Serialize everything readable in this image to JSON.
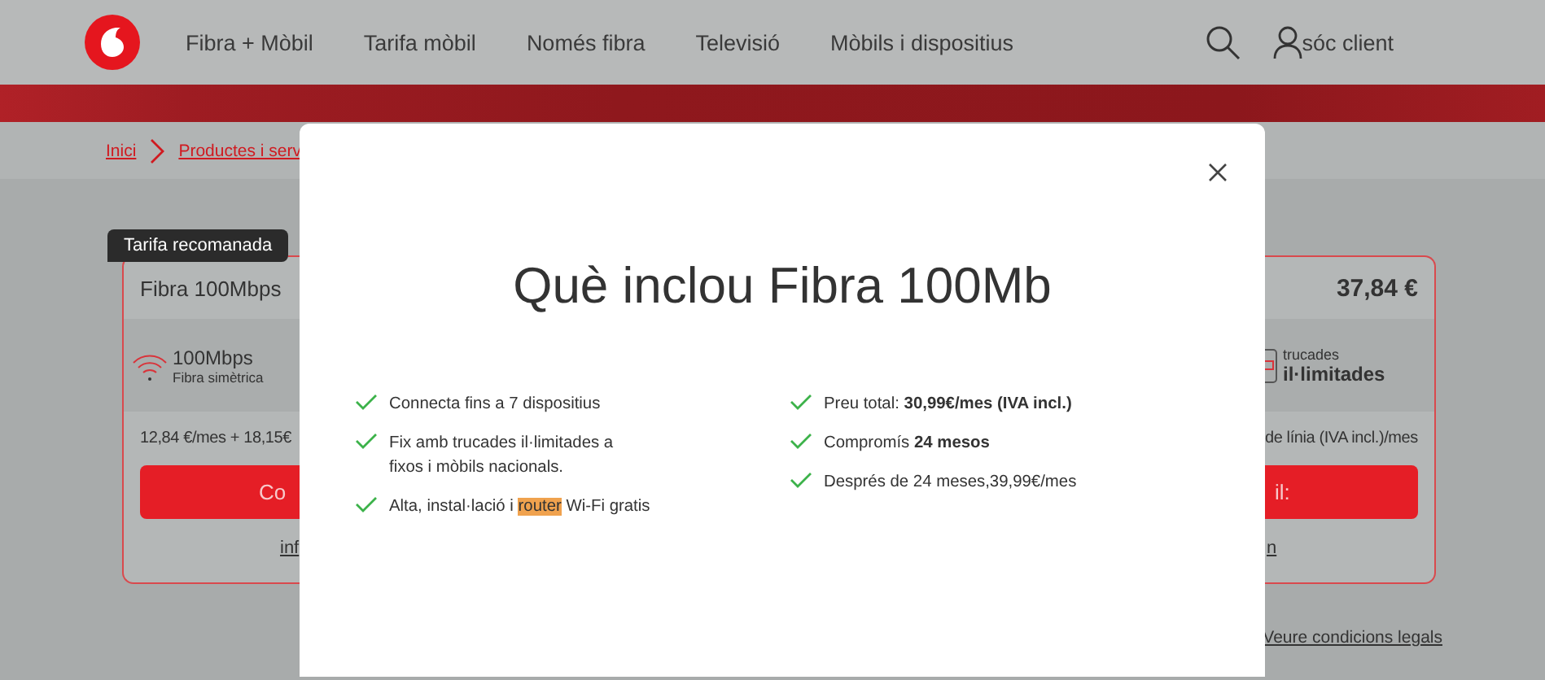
{
  "header": {
    "nav": [
      "Fibra + Mòbil",
      "Tarifa mòbil",
      "Només fibra",
      "Televisió",
      "Mòbils i dispositius"
    ],
    "account": "sóc client"
  },
  "breadcrumb": [
    "Inici",
    "Productes i serv"
  ],
  "left_card": {
    "badge": "Tarifa recomanada",
    "title": "Fibra 100Mbps",
    "speed": "100Mbps",
    "speed_note": "Fibra simètrica",
    "price_line": "12,84 €/mes + 18,15€",
    "button": "Co",
    "link": "inf"
  },
  "right_card": {
    "price": "37,84 €",
    "calls_note": "trucades",
    "calls": "il·limitades",
    "price_line": "de línia (IVA incl.)/mes",
    "button": "il:",
    "link": "n"
  },
  "legal_link": "Veure condicions legals",
  "modal": {
    "title": "Què inclou Fibra 100Mb",
    "left_features": [
      {
        "text": "Connecta fins a 7 dispositius"
      },
      {
        "text": "Fix amb trucades il·limitades a fixos i mòbils nacionals."
      },
      {
        "text": "Alta, instal·lació i ",
        "highlight": "router",
        "after": " Wi-Fi gratis"
      }
    ],
    "right_features": [
      {
        "text": "Preu total: **30,99€/mes (IVA incl.)**"
      },
      {
        "text": "Compromís **24 mesos**"
      },
      {
        "text": "Després de 24 meses,39,99€/mes"
      }
    ]
  }
}
